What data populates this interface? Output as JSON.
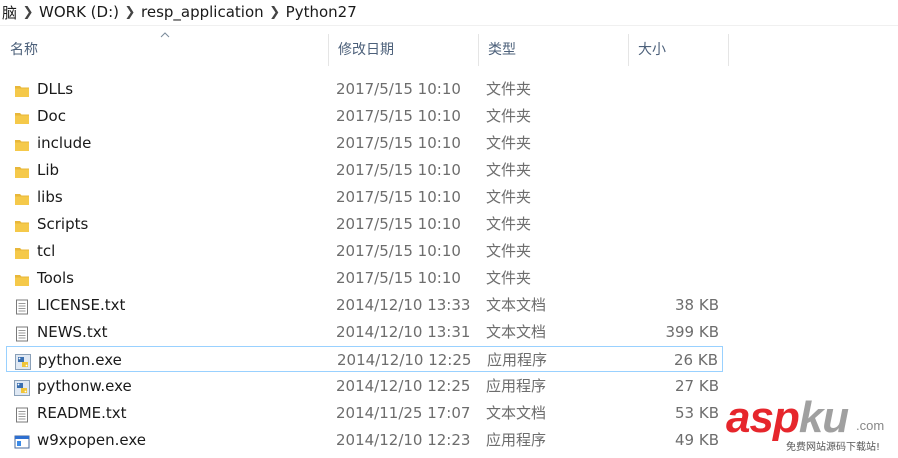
{
  "breadcrumb": {
    "items": [
      "脑",
      "WORK (D:)",
      "resp_application",
      "Python27"
    ]
  },
  "columns": {
    "name": "名称",
    "date": "修改日期",
    "type": "类型",
    "size": "大小"
  },
  "files": [
    {
      "name": "DLLs",
      "date": "2017/5/15 10:10",
      "type": "文件夹",
      "size": "",
      "icon": "folder-icon"
    },
    {
      "name": "Doc",
      "date": "2017/5/15 10:10",
      "type": "文件夹",
      "size": "",
      "icon": "folder-icon"
    },
    {
      "name": "include",
      "date": "2017/5/15 10:10",
      "type": "文件夹",
      "size": "",
      "icon": "folder-icon"
    },
    {
      "name": "Lib",
      "date": "2017/5/15 10:10",
      "type": "文件夹",
      "size": "",
      "icon": "folder-icon"
    },
    {
      "name": "libs",
      "date": "2017/5/15 10:10",
      "type": "文件夹",
      "size": "",
      "icon": "folder-icon"
    },
    {
      "name": "Scripts",
      "date": "2017/5/15 10:10",
      "type": "文件夹",
      "size": "",
      "icon": "folder-icon"
    },
    {
      "name": "tcl",
      "date": "2017/5/15 10:10",
      "type": "文件夹",
      "size": "",
      "icon": "folder-icon"
    },
    {
      "name": "Tools",
      "date": "2017/5/15 10:10",
      "type": "文件夹",
      "size": "",
      "icon": "folder-icon"
    },
    {
      "name": "LICENSE.txt",
      "date": "2014/12/10 13:33",
      "type": "文本文档",
      "size": "38 KB",
      "icon": "text-file-icon"
    },
    {
      "name": "NEWS.txt",
      "date": "2014/12/10 13:31",
      "type": "文本文档",
      "size": "399 KB",
      "icon": "text-file-icon"
    },
    {
      "name": "python.exe",
      "date": "2014/12/10 12:25",
      "type": "应用程序",
      "size": "26 KB",
      "icon": "python-icon",
      "selected": true
    },
    {
      "name": "pythonw.exe",
      "date": "2014/12/10 12:25",
      "type": "应用程序",
      "size": "27 KB",
      "icon": "python-icon"
    },
    {
      "name": "README.txt",
      "date": "2014/11/25 17:07",
      "type": "文本文档",
      "size": "53 KB",
      "icon": "text-file-icon"
    },
    {
      "name": "w9xpopen.exe",
      "date": "2014/12/10 12:23",
      "type": "应用程序",
      "size": "49 KB",
      "icon": "exe-window-icon"
    }
  ],
  "colors": {
    "folder": "#e8b73a",
    "selection_border": "#99d1ff",
    "header_text": "#4c607a",
    "secondary_text": "#6d6d6d"
  },
  "watermark": {
    "brand_a": "asp",
    "brand_b": "ku",
    "domain": ".com",
    "tagline": "免费网站源码下载站!"
  }
}
